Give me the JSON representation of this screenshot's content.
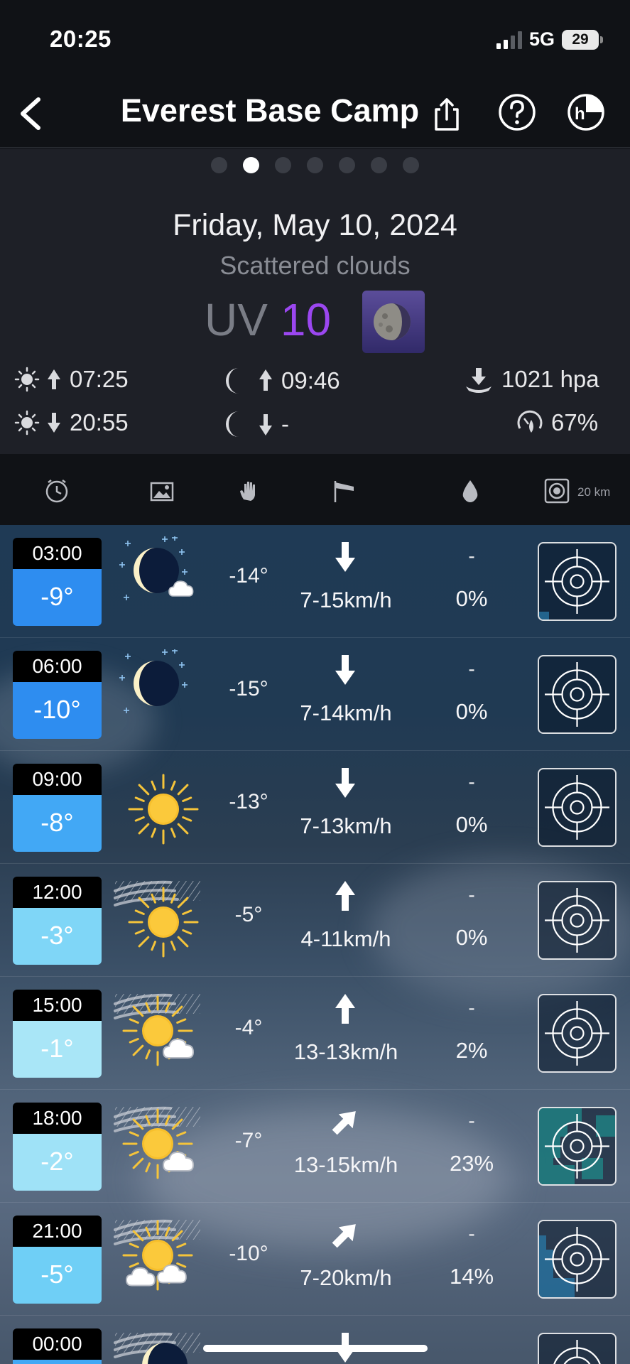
{
  "status": {
    "time": "20:25",
    "network": "5G",
    "battery": "29"
  },
  "header": {
    "title": "Everest Base Camp"
  },
  "pager": {
    "count": 7,
    "active": 1
  },
  "summary": {
    "date": "Friday, May 10, 2024",
    "condition": "Scattered clouds",
    "uv_label": "UV",
    "uv_value": "10",
    "uv_color": "#9b47f0",
    "sunrise": "07:25",
    "sunset": "20:55",
    "moonrise": "09:46",
    "moonset": "-",
    "pressure": "1021 hpa",
    "humidity": "67%"
  },
  "columns": {
    "icons": [
      "clock-icon",
      "image-icon",
      "hand-icon",
      "wind-flag-icon",
      "drop-icon",
      "radar-icon"
    ],
    "radar_radius": "20 km"
  },
  "rows": [
    {
      "time": "03:00",
      "temp": "-9°",
      "temp_color": "#2e8df0",
      "icon": "moon-stars-cloud",
      "feels": "-14°",
      "wind_dir": "down",
      "wind": "7-15km/h",
      "precip": "-",
      "prob": "0%"
    },
    {
      "time": "06:00",
      "temp": "-10°",
      "temp_color": "#2e8df0",
      "icon": "moon-stars",
      "feels": "-15°",
      "wind_dir": "down",
      "wind": "7-14km/h",
      "precip": "-",
      "prob": "0%"
    },
    {
      "time": "09:00",
      "temp": "-8°",
      "temp_color": "#42a8f5",
      "icon": "sun",
      "feels": "-13°",
      "wind_dir": "down",
      "wind": "7-13km/h",
      "precip": "-",
      "prob": "0%"
    },
    {
      "time": "12:00",
      "temp": "-3°",
      "temp_color": "#7fd6f7",
      "icon": "sun-wind",
      "feels": "-5°",
      "wind_dir": "up",
      "wind": "4-11km/h",
      "precip": "-",
      "prob": "0%"
    },
    {
      "time": "15:00",
      "temp": "-1°",
      "temp_color": "#a9e6f7",
      "icon": "sun-cloud-wind",
      "feels": "-4°",
      "wind_dir": "up",
      "wind": "13-13km/h",
      "precip": "-",
      "prob": "2%"
    },
    {
      "time": "18:00",
      "temp": "-2°",
      "temp_color": "#9fe2f7",
      "icon": "sun-cloud-wind",
      "feels": "-7°",
      "wind_dir": "up-right",
      "wind": "13-15km/h",
      "precip": "-",
      "prob": "23%"
    },
    {
      "time": "21:00",
      "temp": "-5°",
      "temp_color": "#6fcff6",
      "icon": "sun-clouds-wind",
      "feels": "-10°",
      "wind_dir": "up-right",
      "wind": "7-20km/h",
      "precip": "-",
      "prob": "14%"
    },
    {
      "time": "00:00",
      "temp": "",
      "temp_color": "#42a8f5",
      "icon": "moon-wind",
      "feels": "",
      "wind_dir": "down",
      "wind": "",
      "precip": "",
      "prob": ""
    }
  ]
}
